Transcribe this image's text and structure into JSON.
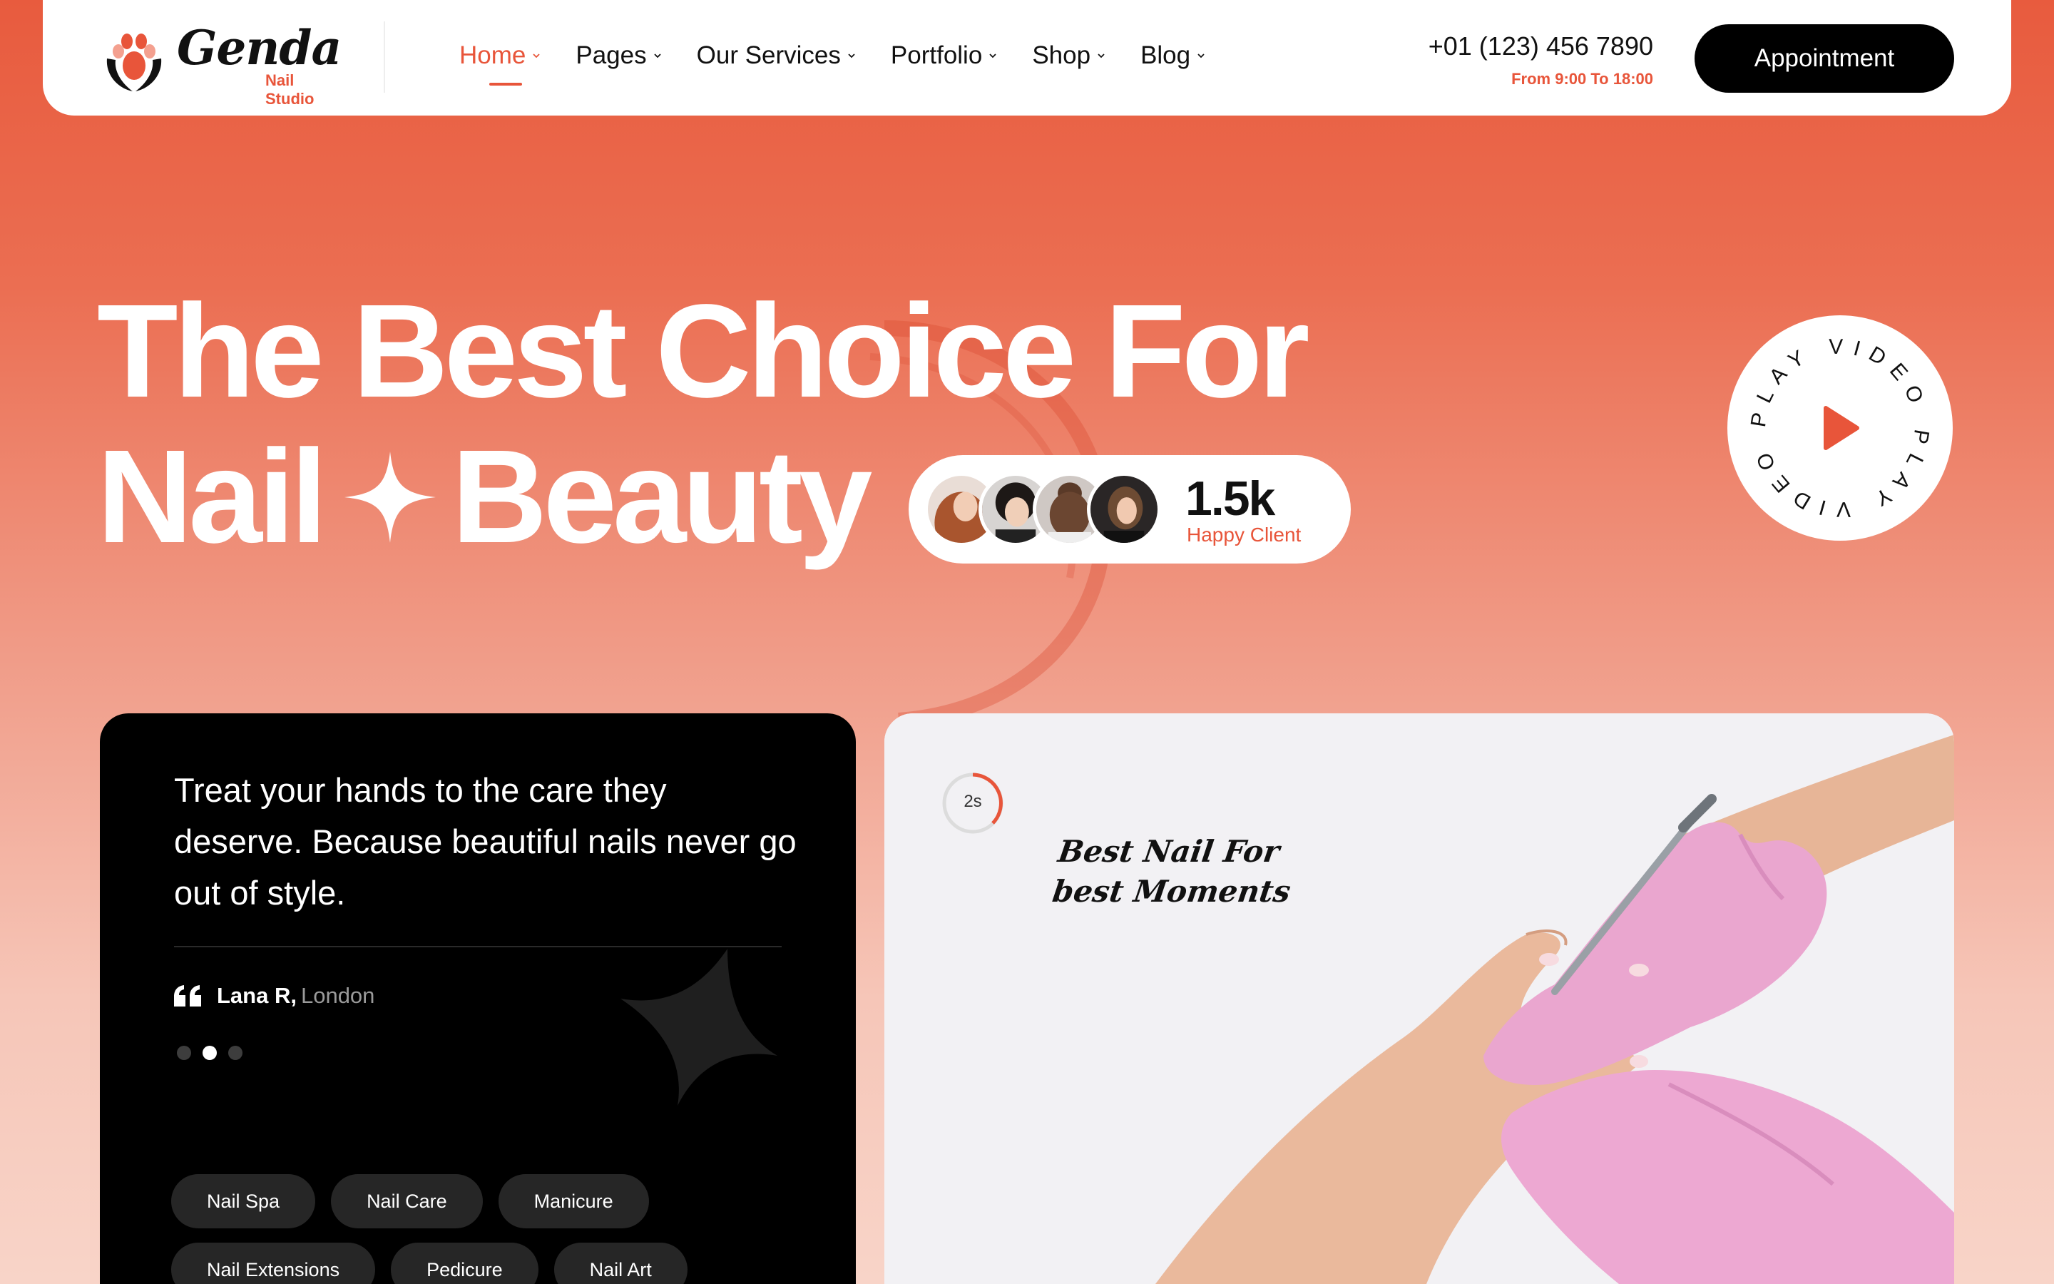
{
  "brand": {
    "name": "Genda",
    "tagline": "Nail Studio",
    "accent": "#e8553a"
  },
  "nav": {
    "items": [
      {
        "label": "Home",
        "active": true
      },
      {
        "label": "Pages"
      },
      {
        "label": "Our Services"
      },
      {
        "label": "Portfolio"
      },
      {
        "label": "Shop"
      },
      {
        "label": "Blog"
      }
    ]
  },
  "contact": {
    "phone": "+01 (123) 456 7890",
    "hours": "From 9:00 To 18:00"
  },
  "cta": {
    "appointment_label": "Appointment"
  },
  "hero": {
    "title_line1": "The Best Choice For",
    "title_word1": "Nail",
    "title_word2": "Beauty",
    "clients_count": "1.5k",
    "clients_label": "Happy Client",
    "play_label": "PLAY VIDEO PLAY VIDEO"
  },
  "testimonial": {
    "text": "Treat your hands to the care they deserve. Because beautiful nails never go out of style.",
    "author": "Lana R,",
    "city": "London",
    "slide_index": 2,
    "slide_total": 3
  },
  "tags": {
    "row1": [
      "Nail Spa",
      "Nail Care",
      "Manicure"
    ],
    "row2": [
      "Nail Extensions",
      "Pedicure",
      "Nail Art"
    ]
  },
  "media": {
    "timer": "2s",
    "script_line1": "Best Nail For",
    "script_line2": "best Moments"
  },
  "icons": [
    "lotus-hands-logo-icon",
    "chevron-down-icon",
    "sparkle-icon",
    "play-icon",
    "quote-icon",
    "star-shape-icon"
  ]
}
